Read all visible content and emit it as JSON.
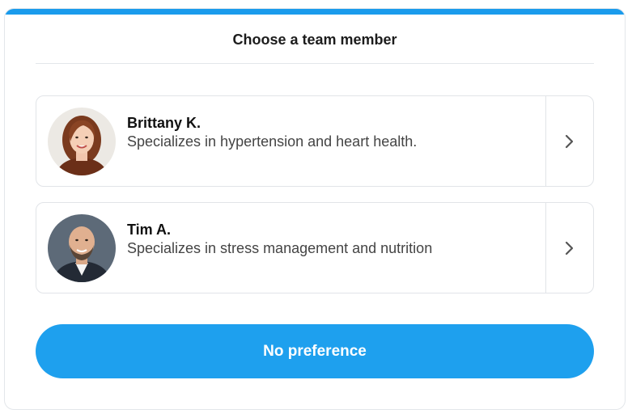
{
  "header": {
    "title": "Choose a team member"
  },
  "members": [
    {
      "name": "Brittany K.",
      "description": "Specializes in hypertension and heart health.",
      "avatar_icon": "woman-portrait-photo",
      "action_icon": "chevron-right-icon"
    },
    {
      "name": "Tim A.",
      "description": "Specializes in stress management and nutrition",
      "avatar_icon": "man-portrait-photo",
      "action_icon": "chevron-right-icon"
    }
  ],
  "actions": {
    "no_preference_label": "No preference"
  },
  "colors": {
    "accent": "#1a9bec",
    "button": "#1ea0ee",
    "border": "#e1e4e8",
    "text_primary": "#111111",
    "text_secondary": "#444444"
  }
}
